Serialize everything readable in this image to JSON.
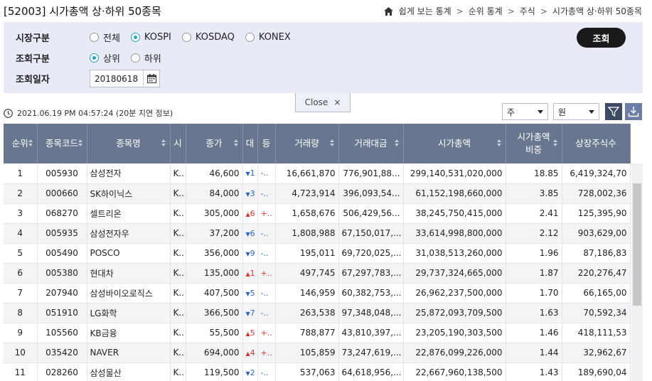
{
  "header": {
    "title": "[52003] 시가총액 상·하위 50종목",
    "breadcrumb": [
      "쉽게 보는 통계",
      "순위 통계",
      "주식",
      "시가총액 상·하위 50종목"
    ]
  },
  "filters": {
    "market_label": "시장구분",
    "market_options": [
      {
        "label": "전체",
        "selected": false
      },
      {
        "label": "KOSPI",
        "selected": true
      },
      {
        "label": "KOSDAQ",
        "selected": false
      },
      {
        "label": "KONEX",
        "selected": false
      }
    ],
    "query_label": "조회구분",
    "query_options": [
      {
        "label": "상위",
        "selected": true
      },
      {
        "label": "하위",
        "selected": false
      }
    ],
    "date_label": "조회일자",
    "date_value": "20180618",
    "search_button": "조회"
  },
  "close_tab": {
    "label": "Close",
    "icon": "×"
  },
  "info": {
    "timestamp": "2021.06.19 PM 04:57:24 (20분 지연 정보)"
  },
  "selects": {
    "unit_share": "주",
    "unit_currency": "원"
  },
  "table": {
    "columns": [
      "순위",
      "종목코드",
      "종목명",
      "시",
      "종가",
      "대",
      "등",
      "거래량",
      "거래대금",
      "시가총액",
      "시가총액 비중",
      "상장주식수"
    ],
    "rows": [
      {
        "rank": "1",
        "code": "005930",
        "name": "삼성전자",
        "mkt": "K..",
        "close": "46,600",
        "dir": "down",
        "diff": "1",
        "pct": "-..",
        "volume": "16,661,870",
        "amount": "776,901,88...",
        "cap": "299,140,531,020,000",
        "ratio": "18.85",
        "shares": "6,419,324,70"
      },
      {
        "rank": "2",
        "code": "000660",
        "name": "SK하이닉스",
        "mkt": "K..",
        "close": "84,000",
        "dir": "down",
        "diff": "3",
        "pct": "-..",
        "volume": "4,723,914",
        "amount": "396,093,54...",
        "cap": "61,152,198,660,000",
        "ratio": "3.85",
        "shares": "728,002,36"
      },
      {
        "rank": "3",
        "code": "068270",
        "name": "셀트리온",
        "mkt": "K..",
        "close": "305,000",
        "dir": "up",
        "diff": "6",
        "pct": "+..",
        "volume": "1,658,676",
        "amount": "506,429,56...",
        "cap": "38,245,750,415,000",
        "ratio": "2.41",
        "shares": "125,395,90"
      },
      {
        "rank": "4",
        "code": "005935",
        "name": "삼성전자우",
        "mkt": "K..",
        "close": "37,200",
        "dir": "down",
        "diff": "6",
        "pct": "-..",
        "volume": "1,808,988",
        "amount": "67,150,017,...",
        "cap": "33,614,998,800,000",
        "ratio": "2.12",
        "shares": "903,629,00"
      },
      {
        "rank": "5",
        "code": "005490",
        "name": "POSCO",
        "mkt": "K..",
        "close": "356,000",
        "dir": "down",
        "diff": "9",
        "pct": "-..",
        "volume": "195,011",
        "amount": "69,720,025,...",
        "cap": "31,038,513,260,000",
        "ratio": "1.96",
        "shares": "87,186,83"
      },
      {
        "rank": "6",
        "code": "005380",
        "name": "현대차",
        "mkt": "K..",
        "close": "135,000",
        "dir": "up",
        "diff": "1",
        "pct": "+..",
        "volume": "497,745",
        "amount": "67,297,783,...",
        "cap": "29,737,324,665,000",
        "ratio": "1.87",
        "shares": "220,276,47"
      },
      {
        "rank": "7",
        "code": "207940",
        "name": "삼성바이오로직스",
        "mkt": "K..",
        "close": "407,500",
        "dir": "down",
        "diff": "5",
        "pct": "-..",
        "volume": "146,959",
        "amount": "60,382,753,...",
        "cap": "26,962,237,500,000",
        "ratio": "1.70",
        "shares": "66,165,00"
      },
      {
        "rank": "8",
        "code": "051910",
        "name": "LG화학",
        "mkt": "K..",
        "close": "366,500",
        "dir": "down",
        "diff": "7",
        "pct": "-..",
        "volume": "263,538",
        "amount": "97,348,048,...",
        "cap": "25,872,093,709,500",
        "ratio": "1.63",
        "shares": "70,592,34"
      },
      {
        "rank": "9",
        "code": "105560",
        "name": "KB금융",
        "mkt": "K..",
        "close": "55,500",
        "dir": "up",
        "diff": "5",
        "pct": "+..",
        "volume": "788,877",
        "amount": "43,810,397,...",
        "cap": "23,205,190,303,500",
        "ratio": "1.46",
        "shares": "418,111,53"
      },
      {
        "rank": "10",
        "code": "035420",
        "name": "NAVER",
        "mkt": "K..",
        "close": "694,000",
        "dir": "up",
        "diff": "4",
        "pct": "+..",
        "volume": "105,859",
        "amount": "73,247,619,...",
        "cap": "22,876,099,226,000",
        "ratio": "1.44",
        "shares": "32,962,67"
      },
      {
        "rank": "11",
        "code": "028260",
        "name": "삼성물산",
        "mkt": "K..",
        "close": "119,500",
        "dir": "down",
        "diff": "2",
        "pct": "-..",
        "volume": "537,063",
        "amount": "64,618,956,...",
        "cap": "22,667,960,138,500",
        "ratio": "1.43",
        "shares": "189,690,04"
      }
    ]
  },
  "colors": {
    "header_bg": "#687690",
    "panel_bg": "#e8ebf6",
    "accent": "#23a5c6",
    "up": "#d9362b",
    "down": "#2a66c8",
    "button_bg": "#1a1a1a",
    "icon_button": "#6c7da8"
  },
  "icons": [
    "home-icon",
    "calendar-icon",
    "clock-icon",
    "filter-icon",
    "download-icon",
    "close-icon"
  ]
}
